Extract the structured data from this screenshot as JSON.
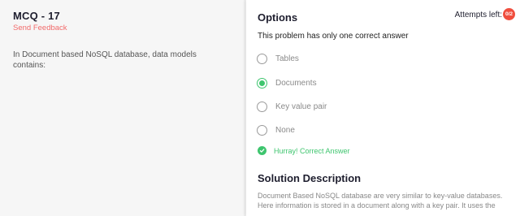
{
  "question": {
    "title": "MCQ - 17",
    "feedback_link": "Send Feedback",
    "text": "In Document based NoSQL database, data models contains:"
  },
  "options_panel": {
    "title": "Options",
    "attempts_label": "Attempts left:",
    "attempts_badge": "0/2",
    "subtitle": "This problem has only one correct answer",
    "options": [
      {
        "label": "Tables",
        "selected": false
      },
      {
        "label": "Documents",
        "selected": true
      },
      {
        "label": "Key value pair",
        "selected": false
      },
      {
        "label": "None",
        "selected": false
      }
    ],
    "result_message": "Hurray! Correct Answer"
  },
  "solution": {
    "title": "Solution Description",
    "text": "Document Based NoSQL database are very similar to key-value databases. Here information is stored in a document along with a key pair. It uses the"
  },
  "colors": {
    "accent_green": "#3ec56e",
    "feedback_red": "#f26b6b",
    "badge_red": "#f04e3e"
  }
}
